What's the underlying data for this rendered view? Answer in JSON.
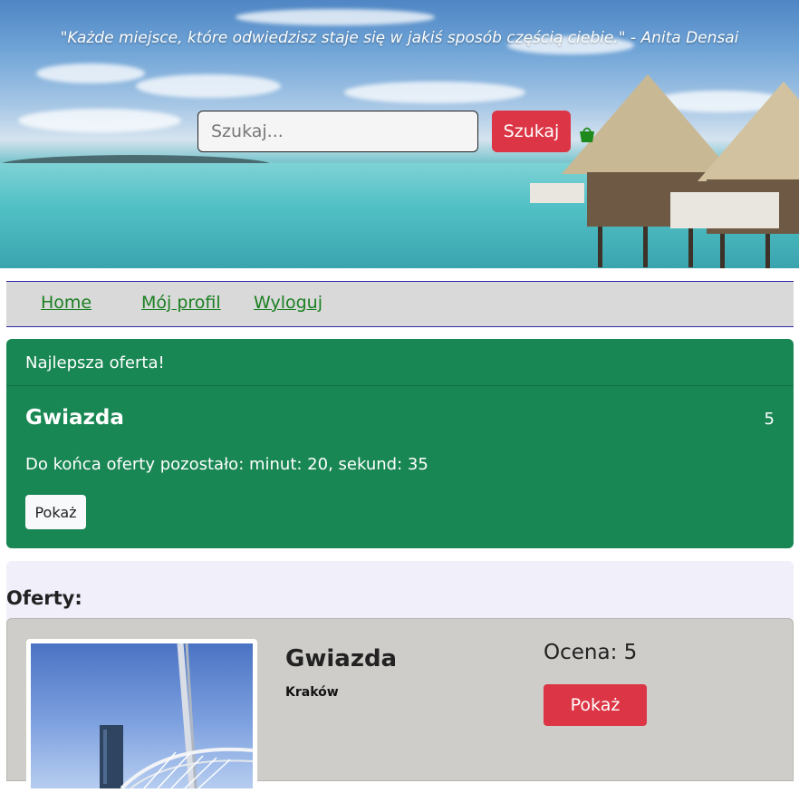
{
  "hero": {
    "quote": "\"Każde miejsce, które odwiedzisz staje się w jakiś sposób częścią ciebie.\" - Anita Densai",
    "search": {
      "placeholder": "Szukaj...",
      "button_label": "Szukaj"
    },
    "basket_icon": "shopping-basket-icon",
    "basket_color": "#1e8a1e"
  },
  "nav": {
    "items": [
      {
        "label": "Home"
      },
      {
        "label": "Mój profil"
      },
      {
        "label": "Wyloguj"
      }
    ]
  },
  "best_offer": {
    "header": "Najlepsza oferta!",
    "title": "Gwiazda",
    "score": "5",
    "timer_text": "Do końca oferty pozostało: minut: 20, sekund: 35",
    "button_label": "Pokaż"
  },
  "offers": {
    "title": "Oferty:",
    "items": [
      {
        "name": "Gwiazda",
        "city": "Kraków",
        "rating": "Ocena: 5",
        "button_label": "Pokaż"
      }
    ]
  },
  "colors": {
    "accent_red": "#dc3545",
    "best_offer_green": "#198754",
    "nav_link_green": "#1a7f22"
  }
}
